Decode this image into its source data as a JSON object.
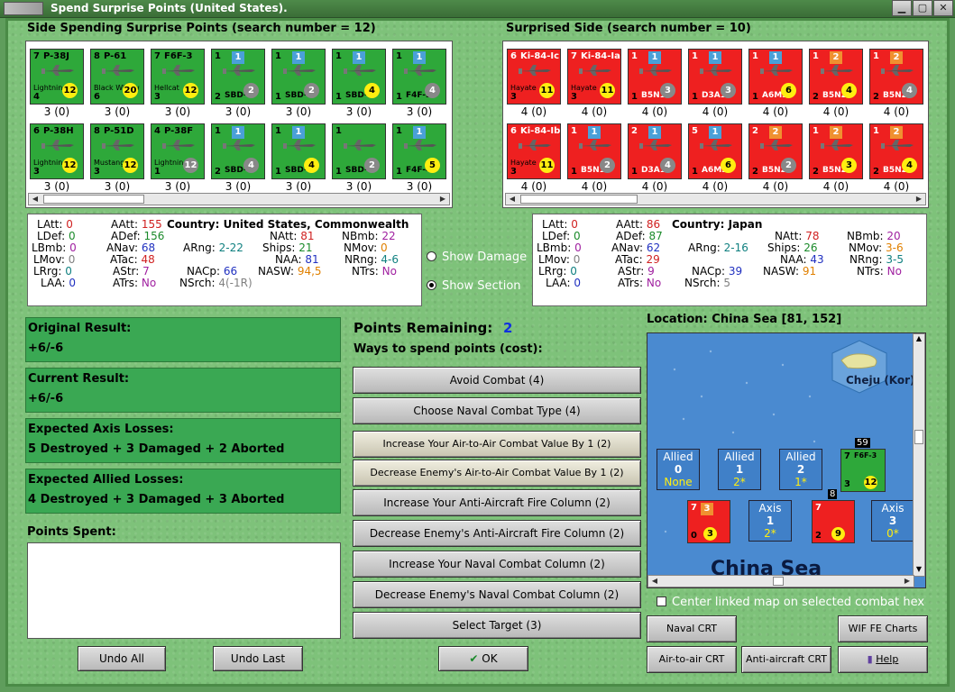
{
  "window": {
    "title": "Spend Surprise Points (United States)."
  },
  "left_header": "Side Spending Surprise Points (search number = 12)",
  "right_header": "Surprised Side (search number = 10)",
  "left_counters": [
    {
      "tl": "7",
      "name": "P-38J",
      "cname": "Lightning",
      "bl": "4",
      "cls": "",
      "circle": "12",
      "circ": "yellow",
      "caption": "3 (0)"
    },
    {
      "tl": "8",
      "name": "P-61",
      "cname": "Black Widow",
      "bl": "6",
      "cls": "",
      "circle": "20",
      "circ": "yellow",
      "caption": "3 (0)"
    },
    {
      "tl": "7",
      "name": "F6F-3",
      "cname": "Hellcat",
      "bl": "3",
      "cls": "",
      "circle": "12",
      "circ": "yellow",
      "caption": "3 (0)"
    },
    {
      "tl": "1",
      "name": "",
      "cname": "",
      "bl": "2",
      "cls": "SBD-4",
      "flag": "1",
      "circle": "2",
      "circ": "grey",
      "caption": "3 (0)"
    },
    {
      "tl": "1",
      "name": "",
      "cname": "",
      "bl": "1",
      "cls": "SBD-1",
      "flag": "1",
      "circle": "2",
      "circ": "grey",
      "caption": "3 (0)"
    },
    {
      "tl": "1",
      "name": "",
      "cname": "",
      "bl": "1",
      "cls": "SBD-4",
      "flag": "1",
      "circle": "4",
      "circ": "yellow",
      "caption": "3 (0)"
    },
    {
      "tl": "1",
      "name": "",
      "cname": "",
      "bl": "1",
      "cls": "F4F-3",
      "flag": "1",
      "circle": "4",
      "circ": "grey",
      "caption": "3 (0)"
    },
    {
      "tl": "6",
      "name": "P-38H",
      "cname": "Lightning",
      "bl": "3",
      "cls": "",
      "circle": "12",
      "circ": "yellow",
      "caption": "3 (0)"
    },
    {
      "tl": "8",
      "name": "P-51D",
      "cname": "Mustang",
      "bl": "3",
      "cls": "",
      "circle": "12",
      "circ": "yellow",
      "caption": "3 (0)"
    },
    {
      "tl": "4",
      "name": "P-38F",
      "cname": "Lightning",
      "bl": "1",
      "cls": "",
      "circle": "12",
      "circ": "grey",
      "caption": "3 (0)"
    },
    {
      "tl": "1",
      "name": "",
      "cname": "",
      "bl": "2",
      "cls": "SBD-3",
      "flag": "1",
      "circle": "4",
      "circ": "grey",
      "caption": "3 (0)"
    },
    {
      "tl": "1",
      "name": "",
      "cname": "",
      "bl": "1",
      "cls": "SBD-4",
      "flag": "1",
      "circle": "4",
      "circ": "yellow",
      "caption": "3 (0)"
    },
    {
      "tl": "1",
      "name": "",
      "cname": "",
      "bl": "1",
      "cls": "SBD-4",
      "flag": "",
      "circle": "2",
      "circ": "grey",
      "caption": "3 (0)"
    },
    {
      "tl": "1",
      "name": "",
      "cname": "",
      "bl": "1",
      "cls": "F4F-4",
      "flag": "1",
      "circle": "5",
      "circ": "yellow",
      "caption": "3 (0)"
    }
  ],
  "right_counters": [
    {
      "tl": "6",
      "name": "Ki-84-Ic",
      "cname": "Hayate",
      "bl": "3",
      "cls": "",
      "circle": "11",
      "circ": "yellow",
      "caption": "4 (0)"
    },
    {
      "tl": "7",
      "name": "Ki-84-Ia",
      "cname": "Hayate",
      "bl": "3",
      "cls": "",
      "circle": "11",
      "circ": "yellow",
      "caption": "4 (0)"
    },
    {
      "tl": "1",
      "name": "",
      "cname": "",
      "bl": "1",
      "cls": "B5N1",
      "flag": "1",
      "fcol": "blue",
      "circle": "3",
      "circ": "grey",
      "caption": "4 (0)"
    },
    {
      "tl": "1",
      "name": "",
      "cname": "",
      "bl": "1",
      "cls": "D3A1",
      "flag": "1",
      "fcol": "blue",
      "circle": "3",
      "circ": "grey",
      "caption": "4 (0)"
    },
    {
      "tl": "1",
      "name": "",
      "cname": "",
      "bl": "1",
      "cls": "A6M3",
      "flag": "1",
      "fcol": "blue",
      "circle": "6",
      "circ": "yellow",
      "caption": "4 (0)"
    },
    {
      "tl": "1",
      "name": "",
      "cname": "",
      "bl": "2",
      "cls": "B5N2",
      "flag": "2",
      "fcol": "orange",
      "circle": "4",
      "circ": "yellow",
      "caption": "4 (0)"
    },
    {
      "tl": "1",
      "name": "",
      "cname": "",
      "bl": "2",
      "cls": "B5N2",
      "flag": "2",
      "fcol": "orange",
      "circle": "4",
      "circ": "grey",
      "caption": "4 (0)"
    },
    {
      "tl": "6",
      "name": "Ki-84-Ib",
      "cname": "Hayate",
      "bl": "3",
      "cls": "",
      "circle": "11",
      "circ": "yellow",
      "caption": "4 (0)"
    },
    {
      "tl": "1",
      "name": "",
      "cname": "",
      "bl": "1",
      "cls": "B5N1",
      "flag": "1",
      "fcol": "blue",
      "circle": "2",
      "circ": "grey",
      "caption": "4 (0)"
    },
    {
      "tl": "2",
      "name": "",
      "cname": "",
      "bl": "1",
      "cls": "D3A1",
      "flag": "1",
      "fcol": "blue",
      "circle": "4",
      "circ": "grey",
      "caption": "4 (0)"
    },
    {
      "tl": "5",
      "name": "",
      "cname": "",
      "bl": "1",
      "cls": "A6M3",
      "flag": "1",
      "fcol": "blue",
      "circle": "6",
      "circ": "yellow",
      "caption": "4 (0)"
    },
    {
      "tl": "2",
      "name": "",
      "cname": "",
      "bl": "2",
      "cls": "B5N2",
      "flag": "2",
      "fcol": "orange",
      "circle": "2",
      "circ": "grey",
      "caption": "4 (0)"
    },
    {
      "tl": "1",
      "name": "",
      "cname": "",
      "bl": "2",
      "cls": "B5N2",
      "flag": "2",
      "fcol": "orange",
      "circle": "3",
      "circ": "yellow",
      "caption": "4 (0)"
    },
    {
      "tl": "1",
      "name": "",
      "cname": "",
      "bl": "2",
      "cls": "B5N2",
      "flag": "2",
      "fcol": "orange",
      "circle": "4",
      "circ": "yellow",
      "caption": "4 (0)"
    }
  ],
  "left_stats": {
    "country_label": "Country:",
    "country": "United States, Commonwealth",
    "LAtt": "0",
    "LDef": "0",
    "LBmb": "0",
    "LMov": "0",
    "LRrg": "0",
    "LAA": "0",
    "AAtt": "155",
    "ADef": "156",
    "ANav": "68",
    "ATac": "48",
    "AStr": "7",
    "ATrs": "No",
    "ARng": "2-22",
    "NACp": "66",
    "NSrch": "4(-1R)",
    "NAtt": "81",
    "Ships": "21",
    "NAA": "81",
    "NASW": "94,5",
    "NBmb": "22",
    "NMov": "0",
    "NRng": "4-6",
    "NTrs": "No"
  },
  "right_stats": {
    "country_label": "Country:",
    "country": "Japan",
    "LAtt": "0",
    "LDef": "0",
    "LBmb": "0",
    "LMov": "0",
    "LRrg": "0",
    "LAA": "0",
    "AAtt": "86",
    "ADef": "87",
    "ANav": "62",
    "ATac": "29",
    "AStr": "9",
    "ATrs": "No",
    "ARng": "2-16",
    "NACp": "39",
    "NSrch": "5",
    "NAtt": "78",
    "Ships": "26",
    "NAA": "43",
    "NASW": "91",
    "NBmb": "20",
    "NMov": "3-6",
    "NRng": "3-5",
    "NTrs": "No"
  },
  "radios": {
    "show_damage": "Show Damage",
    "show_section": "Show Section"
  },
  "results": {
    "original_label": "Original Result:",
    "original_value": "+6/-6",
    "current_label": "Current Result:",
    "current_value": "+6/-6",
    "axis_label": "Expected Axis Losses:",
    "axis_value": "5 Destroyed + 3 Damaged + 2 Aborted",
    "allied_label": "Expected Allied Losses:",
    "allied_value": "4 Destroyed + 3 Damaged + 3 Aborted",
    "spent_label": "Points Spent:"
  },
  "points": {
    "remaining_label": "Points Remaining:",
    "remaining_value": "2",
    "ways_label": "Ways to spend points (cost):"
  },
  "options": [
    "Avoid Combat (4)",
    "Choose Naval Combat Type (4)",
    "Increase Your Air-to-Air Combat Value By 1 (2)",
    "Decrease Enemy's Air-to-Air Combat Value By 1 (2)",
    "Increase Your Anti-Aircraft Fire Column (2)",
    "Decrease Enemy's Anti-Aircraft Fire Column (2)",
    "Increase Your Naval Combat Column (2)",
    "Decrease Enemy's Naval Combat Column (2)",
    "Select Target (3)"
  ],
  "buttons": {
    "undo_all": "Undo All",
    "undo_last": "Undo Last",
    "ok": "OK",
    "naval_crt": "Naval CRT",
    "wif_fe_charts": "WIF FE Charts",
    "air_to_air_crt": "Air-to-air CRT",
    "anti_aircraft_crt": "Anti-aircraft CRT",
    "help": "Help"
  },
  "map": {
    "location": "Location: China Sea [81, 152]",
    "city": "Cheju (Kor)",
    "sea_name": "China Sea",
    "allied_boxes": [
      {
        "t": "Allied",
        "n": "0",
        "s": "None"
      },
      {
        "t": "Allied",
        "n": "1",
        "s": "2*"
      },
      {
        "t": "Allied",
        "n": "2",
        "s": "1*"
      }
    ],
    "axis_boxes": [
      {
        "t": "Axis",
        "n": "1",
        "s": "2*"
      },
      {
        "t": "Axis",
        "n": "3",
        "s": "0*"
      }
    ],
    "stack_us": "59",
    "stack_jp": "8",
    "us_counter": {
      "name": "F6F-3",
      "circle": "12",
      "tl": "7",
      "bl": "3"
    },
    "jp_counter1": {
      "circle": "3",
      "tl": "7",
      "flag": "3",
      "bl": "0"
    },
    "jp_counter2": {
      "circle": "9",
      "tl": "7",
      "bl": "2"
    },
    "center_linked": "Center linked map on selected combat hex"
  }
}
